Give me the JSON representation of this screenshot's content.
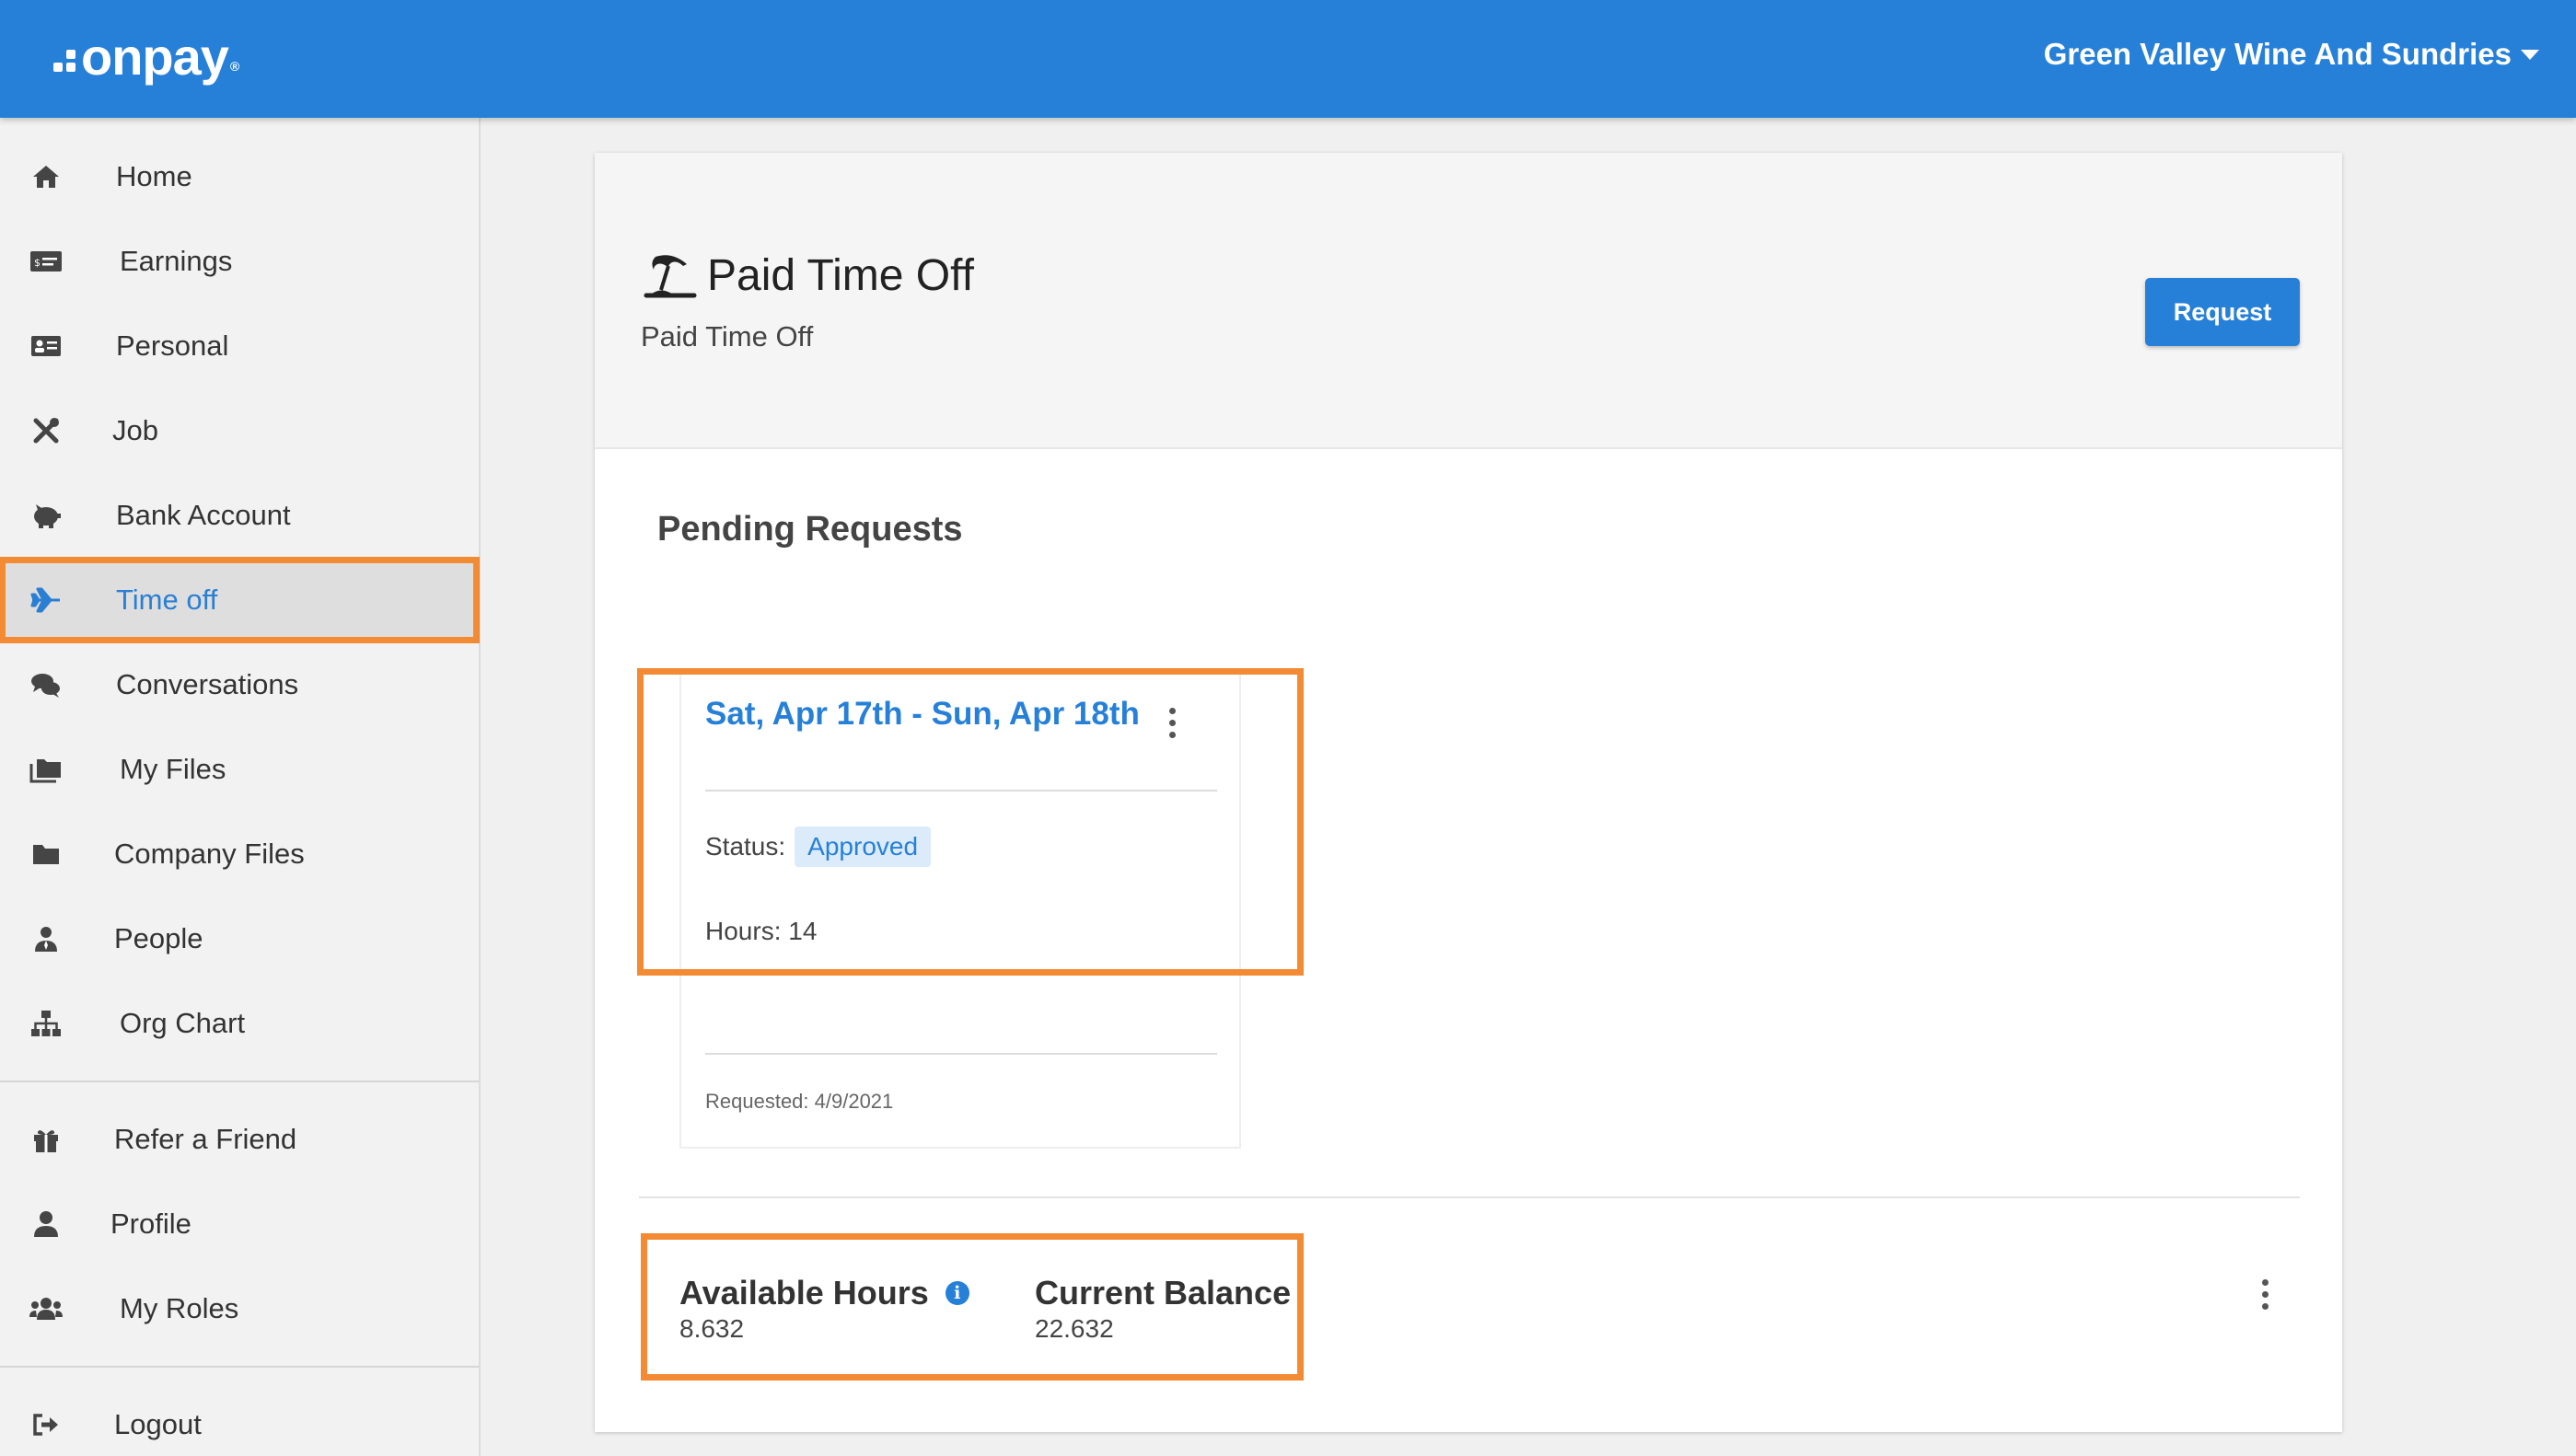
{
  "header": {
    "logo_text": "onpay",
    "logo_mark": "®",
    "company_name": "Green Valley Wine And Sundries"
  },
  "sidebar": {
    "items": [
      {
        "label": "Home",
        "icon": "home-icon"
      },
      {
        "label": "Earnings",
        "icon": "money-check-icon"
      },
      {
        "label": "Personal",
        "icon": "id-card-icon"
      },
      {
        "label": "Job",
        "icon": "tools-icon"
      },
      {
        "label": "Bank Account",
        "icon": "piggy-bank-icon"
      },
      {
        "label": "Time off",
        "icon": "plane-icon",
        "active": true
      },
      {
        "label": "Conversations",
        "icon": "comments-icon"
      },
      {
        "label": "My Files",
        "icon": "folders-icon"
      },
      {
        "label": "Company Files",
        "icon": "folder-icon"
      },
      {
        "label": "People",
        "icon": "user-tie-icon"
      },
      {
        "label": "Org Chart",
        "icon": "sitemap-icon"
      }
    ],
    "secondary_items": [
      {
        "label": "Refer a Friend",
        "icon": "gift-icon"
      },
      {
        "label": "Profile",
        "icon": "user-icon"
      },
      {
        "label": "My Roles",
        "icon": "users-icon"
      }
    ],
    "logout": {
      "label": "Logout",
      "icon": "sign-out-icon"
    }
  },
  "page": {
    "title": "Paid Time Off",
    "subtitle": "Paid Time Off",
    "request_button": "Request"
  },
  "pending": {
    "section_title": "Pending Requests",
    "request": {
      "dates": "Sat, Apr 17th - Sun, Apr 18th",
      "status_label": "Status:",
      "status_value": "Approved",
      "hours_text": "Hours: 14",
      "requested_text": "Requested: 4/9/2021"
    }
  },
  "balance": {
    "available_label": "Available Hours",
    "available_value": "8.632",
    "current_label": "Current Balance",
    "current_value": "22.632"
  },
  "colors": {
    "brand_blue": "#2680d8",
    "highlight_orange": "#f28b34"
  }
}
